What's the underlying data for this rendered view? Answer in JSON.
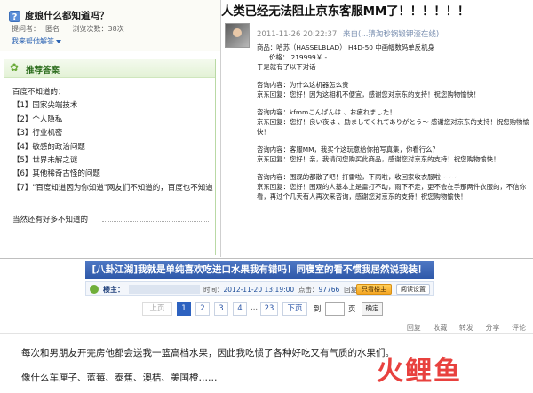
{
  "qa": {
    "question_title": "度娘什么都知道吗？",
    "asker_label": "提问者：",
    "asker_name": "匿名",
    "views": "浏览次数：38次",
    "help_link": "我来帮他解答",
    "answer_header": "推荐答案",
    "answer_intro": "百度不知道的：",
    "answer_items": [
      "【1】国家尖端技术",
      "【2】个人隐私",
      "【3】行业机密",
      "【4】敏感的政治问题",
      "【5】世界未解之谜",
      "【6】其他稀奇古怪的问题",
      "【7】\"百度知道因为你知道\"网友们不知道的，百度也不知道"
    ],
    "answer_footer": "当然还有好多不知道的"
  },
  "jd": {
    "headline": "人类已经无法阻止京东客服MM了！！！！！！",
    "date": "2011-11-26 20:22:37",
    "source_prefix": "来自",
    "source_suffix": "(...猜淘秒锅锻钾渣在线)",
    "lines": [
      "商品：哈苏（HASSELBLAD） H4D-50 中画幅数码单反机身",
      "价格：  219999￥ -",
      "于是就有了以下对话",
      "",
      "咨询内容：为什么这机器怎么贵",
      "京东回复：您好！因为这相机不便宜，感谢您对京东的支持！祝您购物愉快！",
      "",
      "咨询内容：kfmmこんばんは 、お疲れました！",
      "京东回复：您好！良い夜は 、励ましてくれてありがとう～ 感谢您对京东的支持！祝您购物愉快！",
      "",
      "咨询内容：客服MM，我买个这玩意给你拍写真集，你看行么？",
      "京东回复：您好！亲，我请问您购买此商品，感谢您对京东的支持！祝您购物愉快！",
      "",
      "咨询内容：围观的都散了吧！打雷啦，下雨啦，收回家收衣服啦~~~",
      "京东回复：您好！围观的人基本上是雷打不动，雨下不走，更不会在手那两件衣服的，不信你看，再过个几天有人再次来咨询，感谢您对京东的支持！祝您购物愉快！"
    ]
  },
  "bbs": {
    "headline": "[八卦江湖]我就是单纯喜欢吃进口水果我有错吗！同寝室的看不惯我居然说我装！",
    "host_label": "楼主：",
    "time_label": "时间：",
    "time_value": "2012-11-20 13:19:00",
    "clicks_label": "点击：",
    "clicks_value": "97766",
    "replies_label": "回复：",
    "replies_value": "6208",
    "btn_host_only": "只看楼主",
    "btn_read_settings": "阅读设置",
    "pager_prev": "上页",
    "pager_pages": [
      "1",
      "2",
      "3",
      "4"
    ],
    "pager_ellipsis": "...",
    "pager_last": "23",
    "pager_next": "下页",
    "pager_goto": "到",
    "pager_page_unit": "页",
    "pager_confirm": "确定",
    "actions": [
      "回复",
      "收藏",
      "转发",
      "分享",
      "评论"
    ],
    "post_line_1": "每次和男朋友开完房他都会送我一篮高档水果，因此我吃惯了各种好吃又有气质的水果们。",
    "post_line_2": "像什么车厘子、蓝莓、泰蕉、澳桔、美国橙……",
    "logo_text": "火鲤鱼"
  },
  "colors": {
    "tianya_blue": "#2d57a8",
    "zhidao_green": "#6aaa38",
    "logo_red": "#e8413e"
  }
}
